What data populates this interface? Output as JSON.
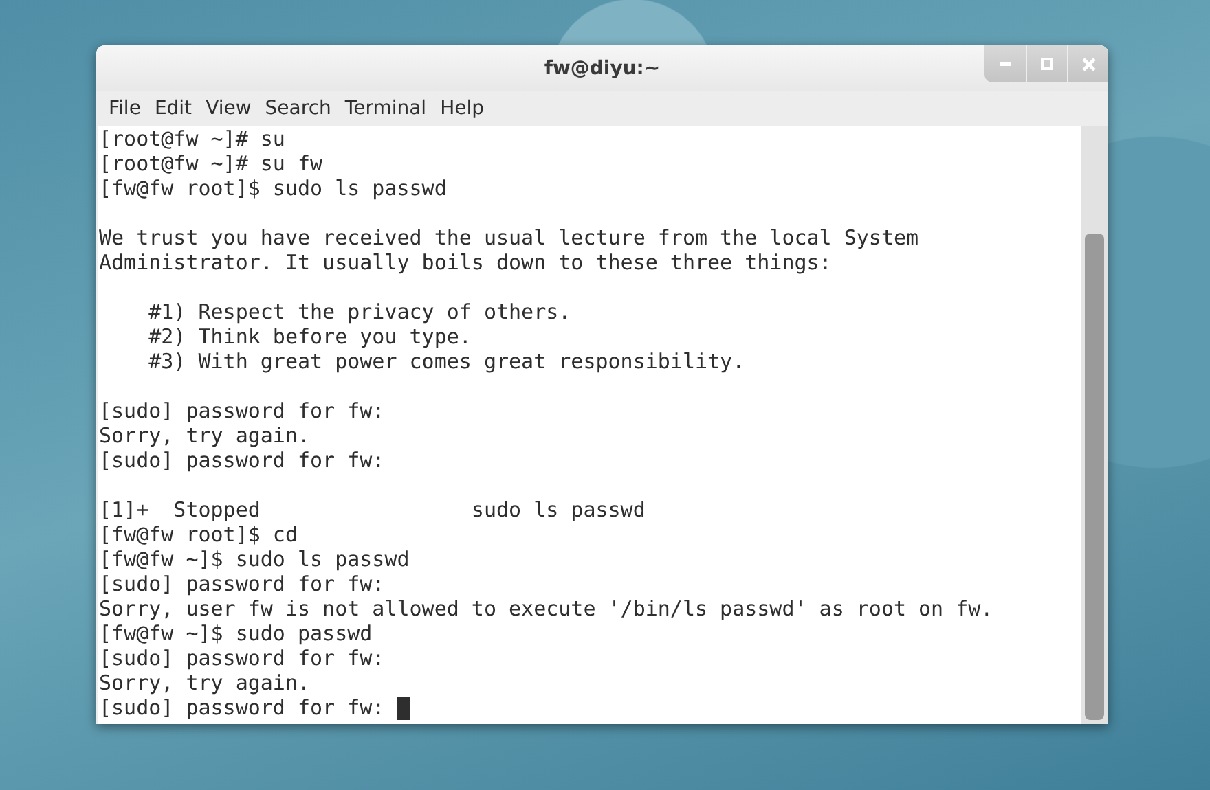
{
  "window": {
    "title": "fw@diyu:~"
  },
  "menu": [
    "File",
    "Edit",
    "View",
    "Search",
    "Terminal",
    "Help"
  ],
  "terminal": {
    "lines": [
      {
        "kind": "text",
        "text": "[root@fw ~]# su"
      },
      {
        "kind": "text",
        "text": "[root@fw ~]# su fw"
      },
      {
        "kind": "text",
        "text": "[fw@fw root]$ sudo ls passwd"
      },
      {
        "kind": "blank"
      },
      {
        "kind": "text",
        "text": "We trust you have received the usual lecture from the local System"
      },
      {
        "kind": "text",
        "text": "Administrator. It usually boils down to these three things:"
      },
      {
        "kind": "blank"
      },
      {
        "kind": "text",
        "text": "    #1) Respect the privacy of others."
      },
      {
        "kind": "text",
        "text": "    #2) Think before you type."
      },
      {
        "kind": "text",
        "text": "    #3) With great power comes great responsibility."
      },
      {
        "kind": "blank"
      },
      {
        "kind": "text",
        "text": "[sudo] password for fw:"
      },
      {
        "kind": "text",
        "text": "Sorry, try again."
      },
      {
        "kind": "text",
        "text": "[sudo] password for fw:"
      },
      {
        "kind": "blank"
      },
      {
        "kind": "text",
        "text": "[1]+  Stopped                 sudo ls passwd"
      },
      {
        "kind": "text",
        "text": "[fw@fw root]$ cd"
      },
      {
        "kind": "text",
        "text": "[fw@fw ~]$ sudo ls passwd"
      },
      {
        "kind": "text",
        "text": "[sudo] password for fw:"
      },
      {
        "kind": "text",
        "text": "Sorry, user fw is not allowed to execute '/bin/ls passwd' as root on fw."
      },
      {
        "kind": "text",
        "text": "[fw@fw ~]$ sudo passwd"
      },
      {
        "kind": "text",
        "text": "[sudo] password for fw:"
      },
      {
        "kind": "text",
        "text": "Sorry, try again."
      },
      {
        "kind": "cursor",
        "text": "[sudo] password for fw: "
      }
    ]
  }
}
